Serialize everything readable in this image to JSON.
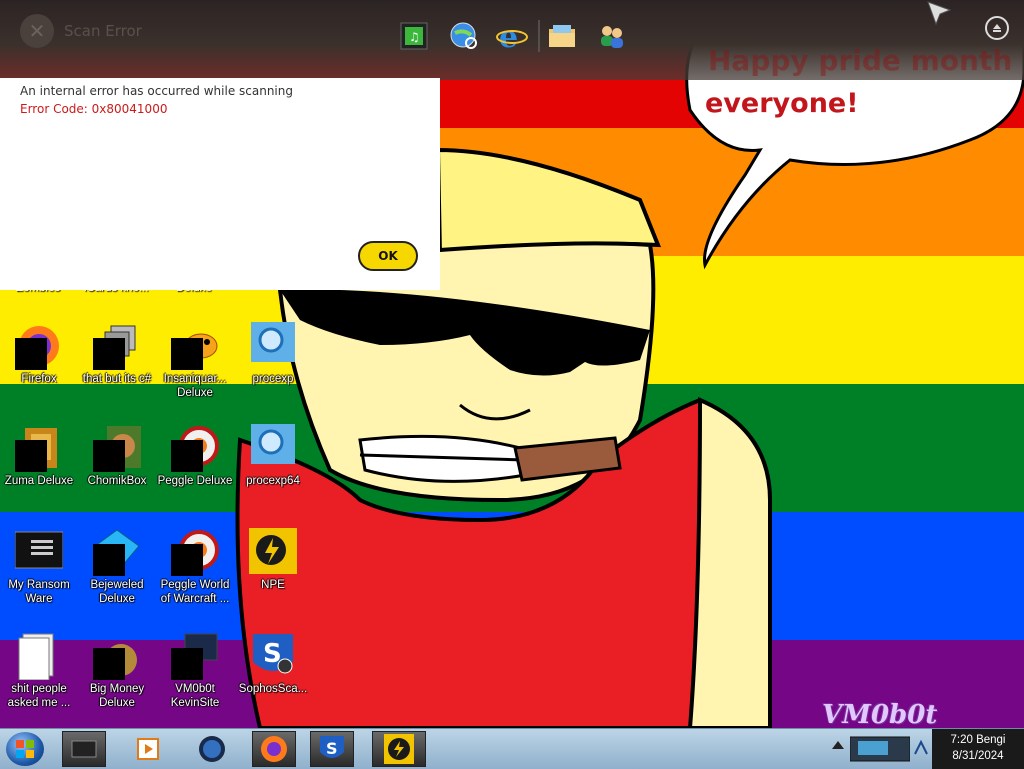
{
  "dock": {
    "title": "Scan Error",
    "icons": [
      "notes-icon",
      "globe-search-icon",
      "internet-explorer-icon",
      "folder-icon",
      "users-icon"
    ]
  },
  "dialog": {
    "message": "An internal error has occurred while scanning",
    "error_code": "Error Code: 0x80041000",
    "ok_label": "OK",
    "error_color": "#cc1a1a",
    "button_color": "#f6d800"
  },
  "speech": {
    "line1": "Happy pride month",
    "line2": "everyone!"
  },
  "partial_labels": [
    "Zombies",
    "iCards kno...",
    "Deluxe"
  ],
  "desktop_icons": [
    {
      "label": "Firefox",
      "icon": "firefox-icon"
    },
    {
      "label": "that but its c#",
      "icon": "stack-icon"
    },
    {
      "label": "Insaniquarium Deluxe",
      "display": "Insaniquar... Deluxe",
      "icon": "fish-icon"
    },
    {
      "label": "procexp",
      "icon": "process-explorer-icon"
    },
    {
      "label": "Zuma Deluxe",
      "icon": "zuma-icon"
    },
    {
      "label": "ChomikBox",
      "icon": "hamster-icon"
    },
    {
      "label": "Peggle Deluxe",
      "icon": "peggle-icon"
    },
    {
      "label": "procexp64",
      "icon": "process-explorer-icon"
    },
    {
      "label": "My Ransom Ware",
      "icon": "console-icon"
    },
    {
      "label": "Bejeweled Deluxe",
      "icon": "gem-icon"
    },
    {
      "label": "Peggle World of Warcraft ...",
      "icon": "peggle-icon"
    },
    {
      "label": "NPE",
      "icon": "npe-icon"
    },
    {
      "label": "shit people asked me ...",
      "icon": "document-icon"
    },
    {
      "label": "Big Money Deluxe",
      "icon": "money-bag-icon"
    },
    {
      "label": "VM0b0t KevinSite",
      "icon": "monitor-icon"
    },
    {
      "label": "SophosSca...",
      "icon": "sophos-icon"
    }
  ],
  "taskbar": {
    "buttons": [
      "window-icon",
      "media-player-icon",
      "globe-icon",
      "firefox-icon",
      "sophos-icon",
      "npe-icon"
    ],
    "clock_time": "7:20 Bengi",
    "clock_date": "8/31/2024"
  },
  "signature": "VM0b0t",
  "colors": {
    "stripes": [
      "#e40303",
      "#ff8c00",
      "#ffed00",
      "#008026",
      "#004dff",
      "#750787"
    ],
    "taskbar": "#9db9d2"
  }
}
